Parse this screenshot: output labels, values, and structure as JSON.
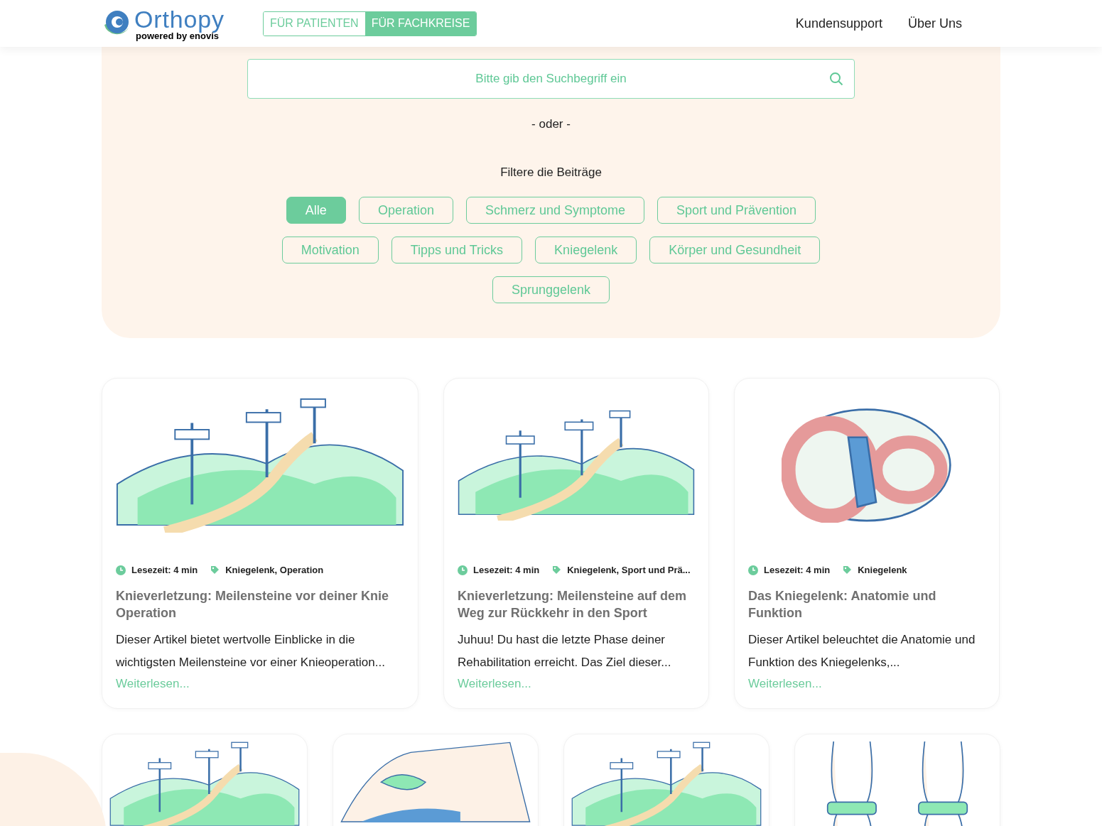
{
  "header": {
    "logo": {
      "name": "Orthopy",
      "tagline": "powered by enovis"
    },
    "audience_tabs": [
      {
        "label": "FÜR PATIENTEN",
        "selected": false
      },
      {
        "label": "FÜR FACHKREISE",
        "selected": true
      }
    ],
    "nav_links": [
      "Kundensupport",
      "Über Uns"
    ]
  },
  "search": {
    "placeholder": "Bitte gib den Suchbegriff ein"
  },
  "or_divider": "- oder -",
  "filter_title": "Filtere die Beiträge",
  "filter_rows": [
    [
      {
        "label": "Alle",
        "selected": true
      },
      {
        "label": "Operation",
        "selected": false
      },
      {
        "label": "Schmerz und Symptome",
        "selected": false
      },
      {
        "label": "Sport und Prävention",
        "selected": false
      }
    ],
    [
      {
        "label": "Motivation",
        "selected": false
      },
      {
        "label": "Tipps und Tricks",
        "selected": false
      },
      {
        "label": "Kniegelenk",
        "selected": false
      },
      {
        "label": "Körper und Gesundheit",
        "selected": false
      }
    ],
    [
      {
        "label": "Sprunggelenk",
        "selected": false
      }
    ]
  ],
  "articles": [
    {
      "kind": "hills",
      "reading_time": "Lesezeit: 4 min",
      "tags": "Kniegelenk, Operation",
      "title": "Knieverletzung: Meilensteine vor deiner Knie Operation",
      "excerpt": "Dieser Artikel bietet wertvolle Einblicke in die wichtigsten Meilensteine vor einer Knieoperation...",
      "read_more": "Weiterlesen..."
    },
    {
      "kind": "hills",
      "reading_time": "Lesezeit: 4 min",
      "tags": "Kniegelenk, Sport und Prä...",
      "title": "Knieverletzung: Meilensteine auf dem Weg zur Rückkehr in den Sport",
      "excerpt": "Juhuu! Du hast die letzte Phase deiner Rehabilitation erreicht. Das Ziel dieser...",
      "read_more": "Weiterlesen..."
    },
    {
      "kind": "knee-anatomy",
      "reading_time": "Lesezeit: 4 min",
      "tags": "Kniegelenk",
      "title": "Das Kniegelenk: Anatomie und Funktion",
      "excerpt": "Dieser Artikel beleuchtet die Anatomie und Funktion des Kniegelenks,...",
      "read_more": "Weiterlesen..."
    }
  ],
  "more_articles": [
    {
      "kind": "hills"
    },
    {
      "kind": "hands-on-knee"
    },
    {
      "kind": "hills"
    },
    {
      "kind": "knee-joints"
    }
  ]
}
